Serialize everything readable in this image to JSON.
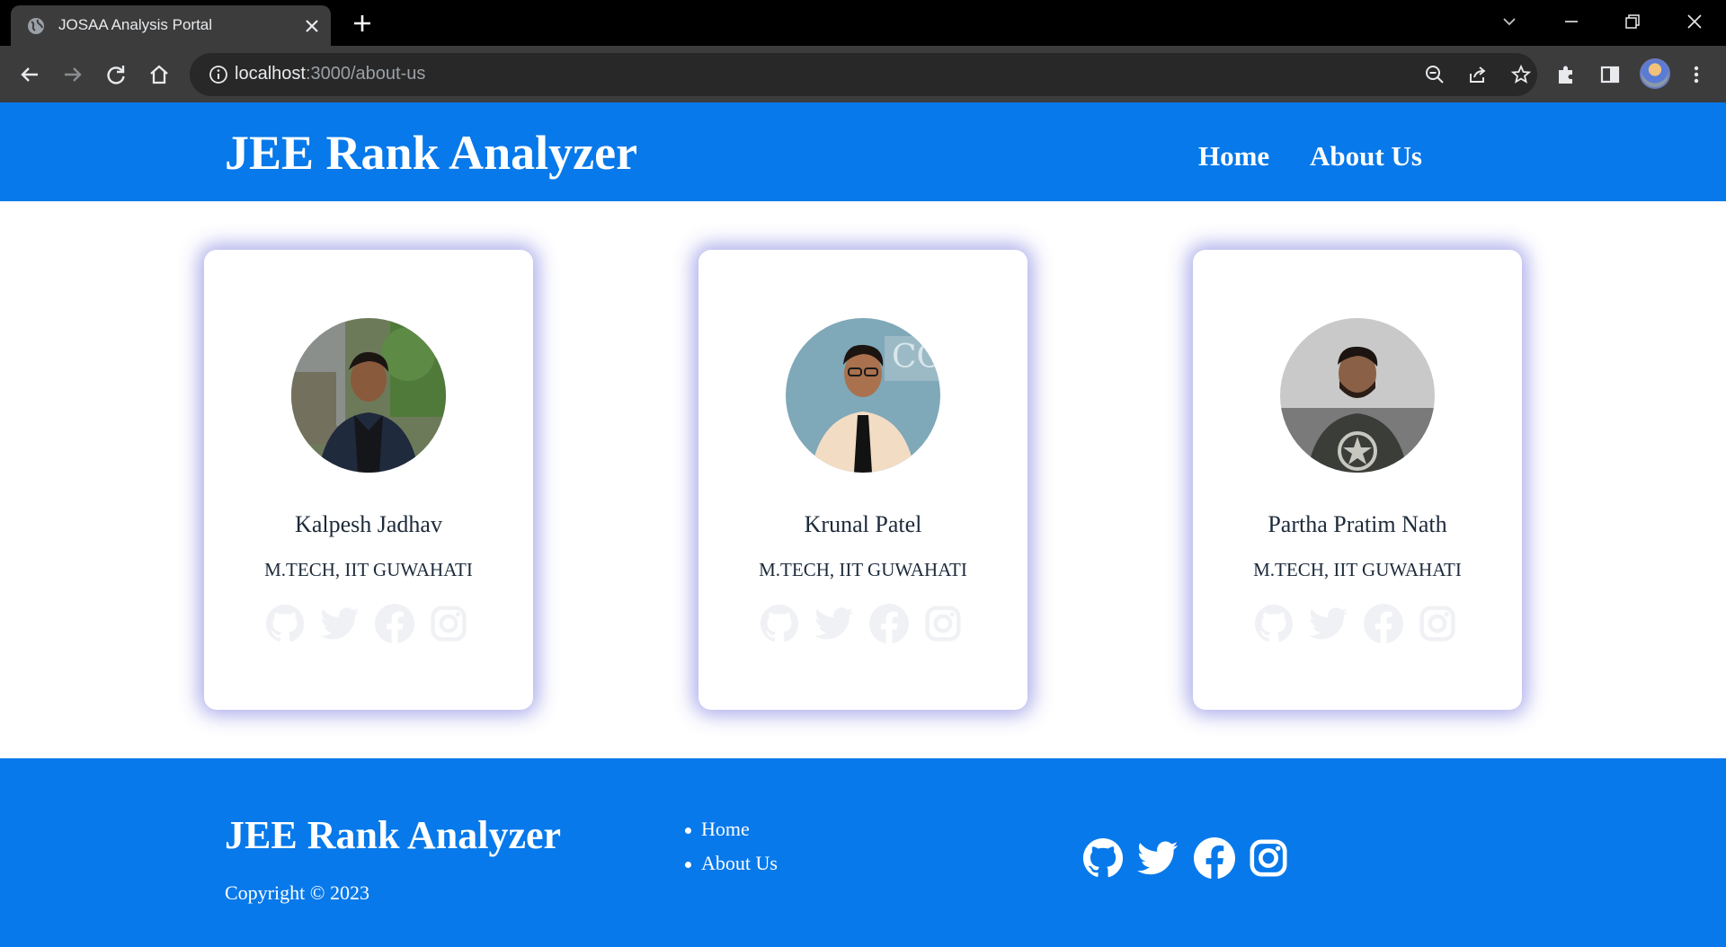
{
  "browser": {
    "tab_title": "JOSAA Analysis Portal",
    "url_host": "localhost",
    "url_rest": ":3000/about-us"
  },
  "header": {
    "brand": "JEE Rank Analyzer",
    "nav": [
      {
        "label": "Home"
      },
      {
        "label": "About Us"
      }
    ]
  },
  "team": [
    {
      "name": "Kalpesh Jadhav",
      "degree": "M.TECH, IIT GUWAHATI"
    },
    {
      "name": "Krunal Patel",
      "degree": "M.TECH, IIT GUWAHATI"
    },
    {
      "name": "Partha Pratim Nath",
      "degree": "M.TECH, IIT GUWAHATI"
    }
  ],
  "card_social_icons": [
    "github-icon",
    "twitter-icon",
    "facebook-icon",
    "instagram-icon"
  ],
  "footer": {
    "brand": "JEE Rank Analyzer",
    "copyright": "Copyright © 2023",
    "links": [
      {
        "label": "Home"
      },
      {
        "label": "About Us"
      }
    ],
    "social_icons": [
      "github-icon",
      "twitter-icon",
      "facebook-icon",
      "instagram-icon"
    ]
  },
  "colors": {
    "brand_blue": "#0779ea",
    "card_shadow": "#4646d2",
    "faded_icon": "#f0f1f4"
  }
}
